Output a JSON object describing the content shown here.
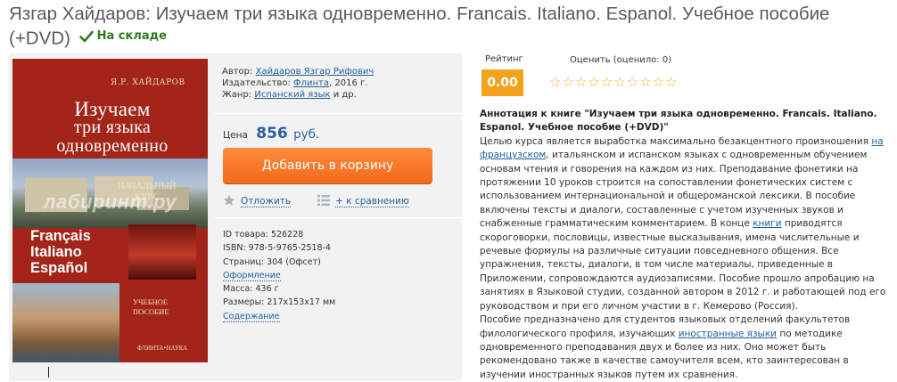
{
  "title": {
    "text": "Язгар Хайдаров: Изучаем три языка одновременно. Francais. Italiano. Espanol. Учебное пособие (+DVD)",
    "stock": "На складе"
  },
  "cover": {
    "author": "Я.Р. ХАЙДАРОВ",
    "title_line1": "Изучаем",
    "title_line2": "три языка",
    "title_line3": "одновременно",
    "course_line1": "НАЧАЛЬНЫЙ",
    "course_line2": "КУРС",
    "watermark": "лабиринт.ру",
    "lang1": "Français",
    "lang2": "Italiano",
    "lang3": "Español",
    "subtitle_line1": "УЧЕБНОЕ",
    "subtitle_line2": "ПОСОБИЕ",
    "publisher": "ФЛИНТА•НАУКА"
  },
  "info": {
    "author_label": "Автор:",
    "author": "Хайдаров Язгар Рифович",
    "publisher_label": "Издательство:",
    "publisher": "Флинта",
    "publisher_year": ", 2016 г.",
    "genre_label": "Жанр:",
    "genre": "Испанский язык",
    "genre_suffix": " и др."
  },
  "price": {
    "label": "Цена",
    "value": "856",
    "currency": "руб."
  },
  "cart_button": "Добавить в корзину",
  "actions": {
    "postpone": "Отложить",
    "compare": "+ к сравнению"
  },
  "specs": {
    "id": "ID товара: 526228",
    "isbn": "ISBN: 978-5-9765-2518-4",
    "pages": "Страниц: 304 (Офсет)",
    "design_link": "Оформление",
    "weight": "Масса: 436 г",
    "size": "Размеры: 217x153x17 мм",
    "contents_link": "Содержание"
  },
  "rating": {
    "label": "Рейтинг",
    "value": "0.00",
    "rate_label": "Оценить (оценило: 0)",
    "stars_count": 10
  },
  "colors": {
    "accent_orange": "#f26a1b",
    "rating_bg": "#f4a21c",
    "link": "#1f5f9e",
    "stock_green": "#2e7a1e"
  },
  "annotation": {
    "heading": "Аннотация к книге \"Изучаем три языка одновременно. Francais. Italiano. Espanol. Учебное пособие (+DVD)\"",
    "p1_a": "Целью курса является выработка максимально безакцентного произношения ",
    "p1_link1": "на французском",
    "p1_b": ", итальянском и испанском языках с одновременным обучением основам чтения и говорения на каждом из них. Преподавание фонетики на протяжении 10 уроков строится на сопоставлении фонетических систем с использованием интернациональной и общероманской лексики. В пособие включены тексты и диалоги, составленные с учетом изученных звуков и снабженные грамматическим комментарием. В конце ",
    "p1_link2": "книги",
    "p1_c": " приводятся скороговорки, пословицы, известные высказывания, имена числительные и речевые формулы на различные ситуации повседневного общения. Все упражнения, тексты, диалоги, в том числе материалы, приведенные в Приложении, сопровождаются аудиозаписями. Пособие прошло апробацию на занятиях в Языковой студии, созданной автором в 2012 г. и работающей под его руководством и при его личном участии в г. Кемерово (Россия).",
    "p2_a": "Пособие предназначено для студентов языковых отделений факультетов филологического профиля, изучающих ",
    "p2_link": "иностранные языки",
    "p2_b": " по методике одновременного преподавания двух и более из них. Оно может быть рекомендовано также в качестве самоучителя всем, кто заинтересован в изучении иностранных языков путем их сравнения."
  }
}
